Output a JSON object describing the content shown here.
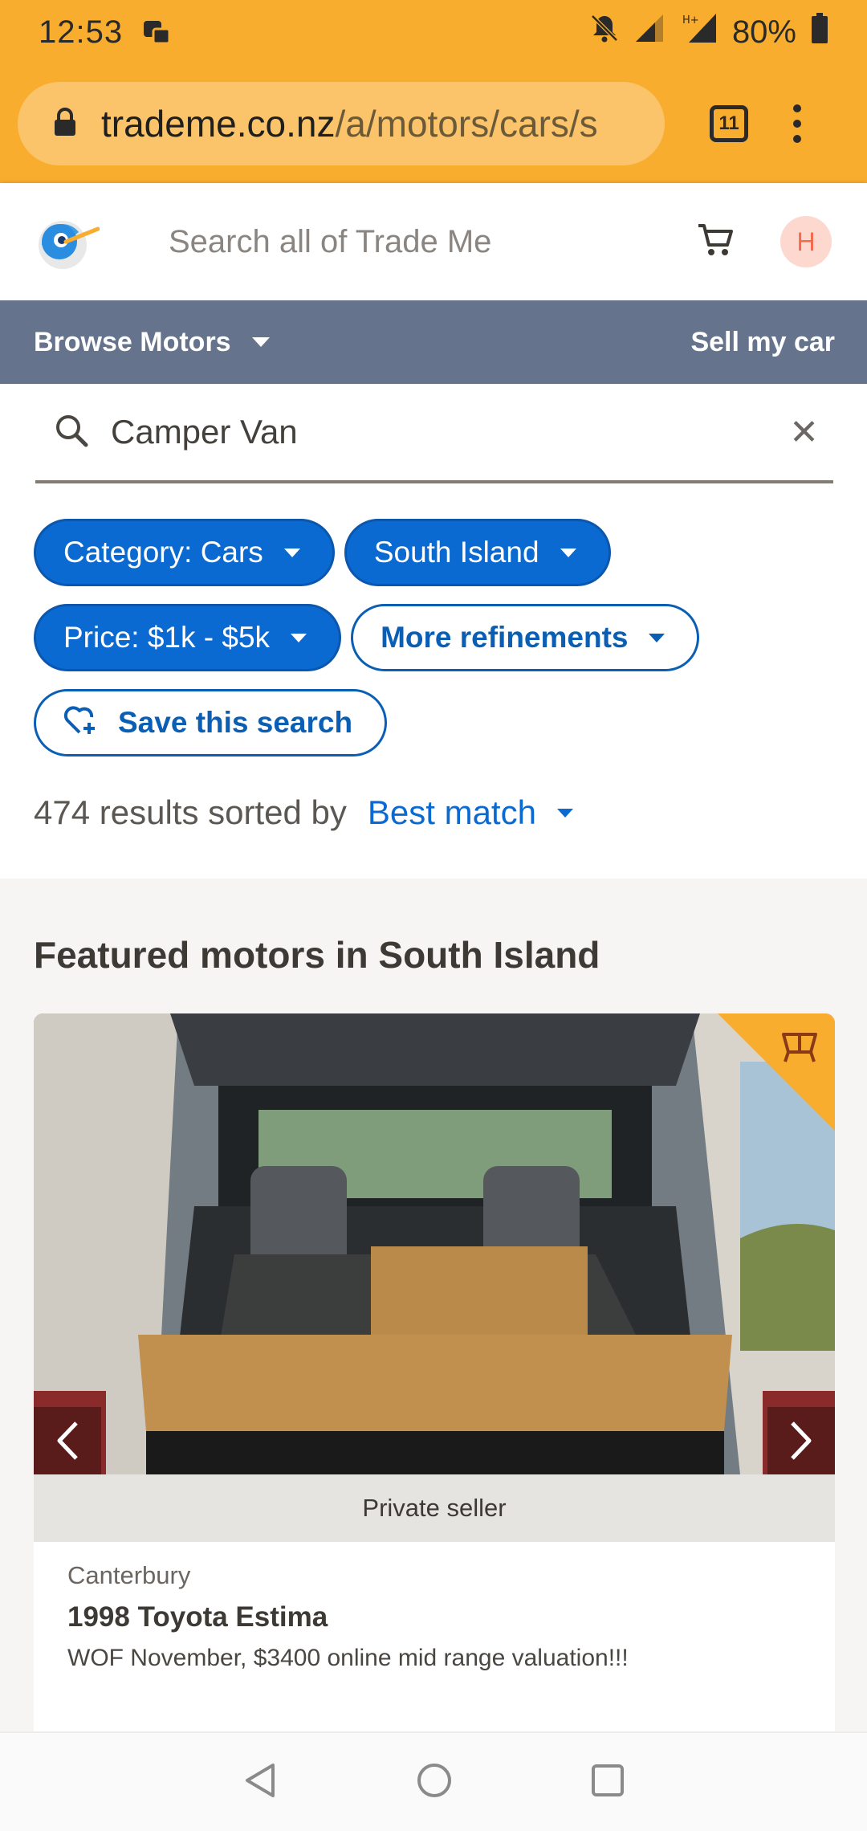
{
  "status_bar": {
    "time": "12:53",
    "battery": "80%",
    "icons": [
      "notification-icon",
      "mute-icon",
      "signal-icon",
      "network-icon",
      "battery-icon"
    ]
  },
  "browser": {
    "url_host": "trademe.co.nz",
    "url_path": "/a/motors/cars/s",
    "tab_count": "11",
    "icons": [
      "lock-icon",
      "tabs-icon",
      "menu-icon"
    ]
  },
  "site_header": {
    "search_placeholder": "Search all of Trade Me",
    "avatar_initial": "H",
    "icons": [
      "trademe-logo-icon",
      "cart-icon"
    ]
  },
  "motors_nav": {
    "browse_label": "Browse Motors",
    "sell_label": "Sell my car"
  },
  "search": {
    "value": "Camper Van",
    "clear_symbol": "✕"
  },
  "filters": {
    "category": "Category: Cars",
    "region": "South Island",
    "price": "Price: $1k - $5k",
    "more": "More refinements",
    "save": "Save this search"
  },
  "results": {
    "count_text": "474 results sorted by",
    "sort_value": "Best match"
  },
  "featured": {
    "title": "Featured motors in South Island",
    "listing": {
      "seller_type": "Private seller",
      "location": "Canterbury",
      "title": "1998 Toyota Estima",
      "description": "WOF November, $3400 online mid range valuation!!!"
    }
  },
  "colors": {
    "accent_orange": "#f9ad2e",
    "nav_slate": "#65738c",
    "link_blue": "#0a6ad1"
  }
}
